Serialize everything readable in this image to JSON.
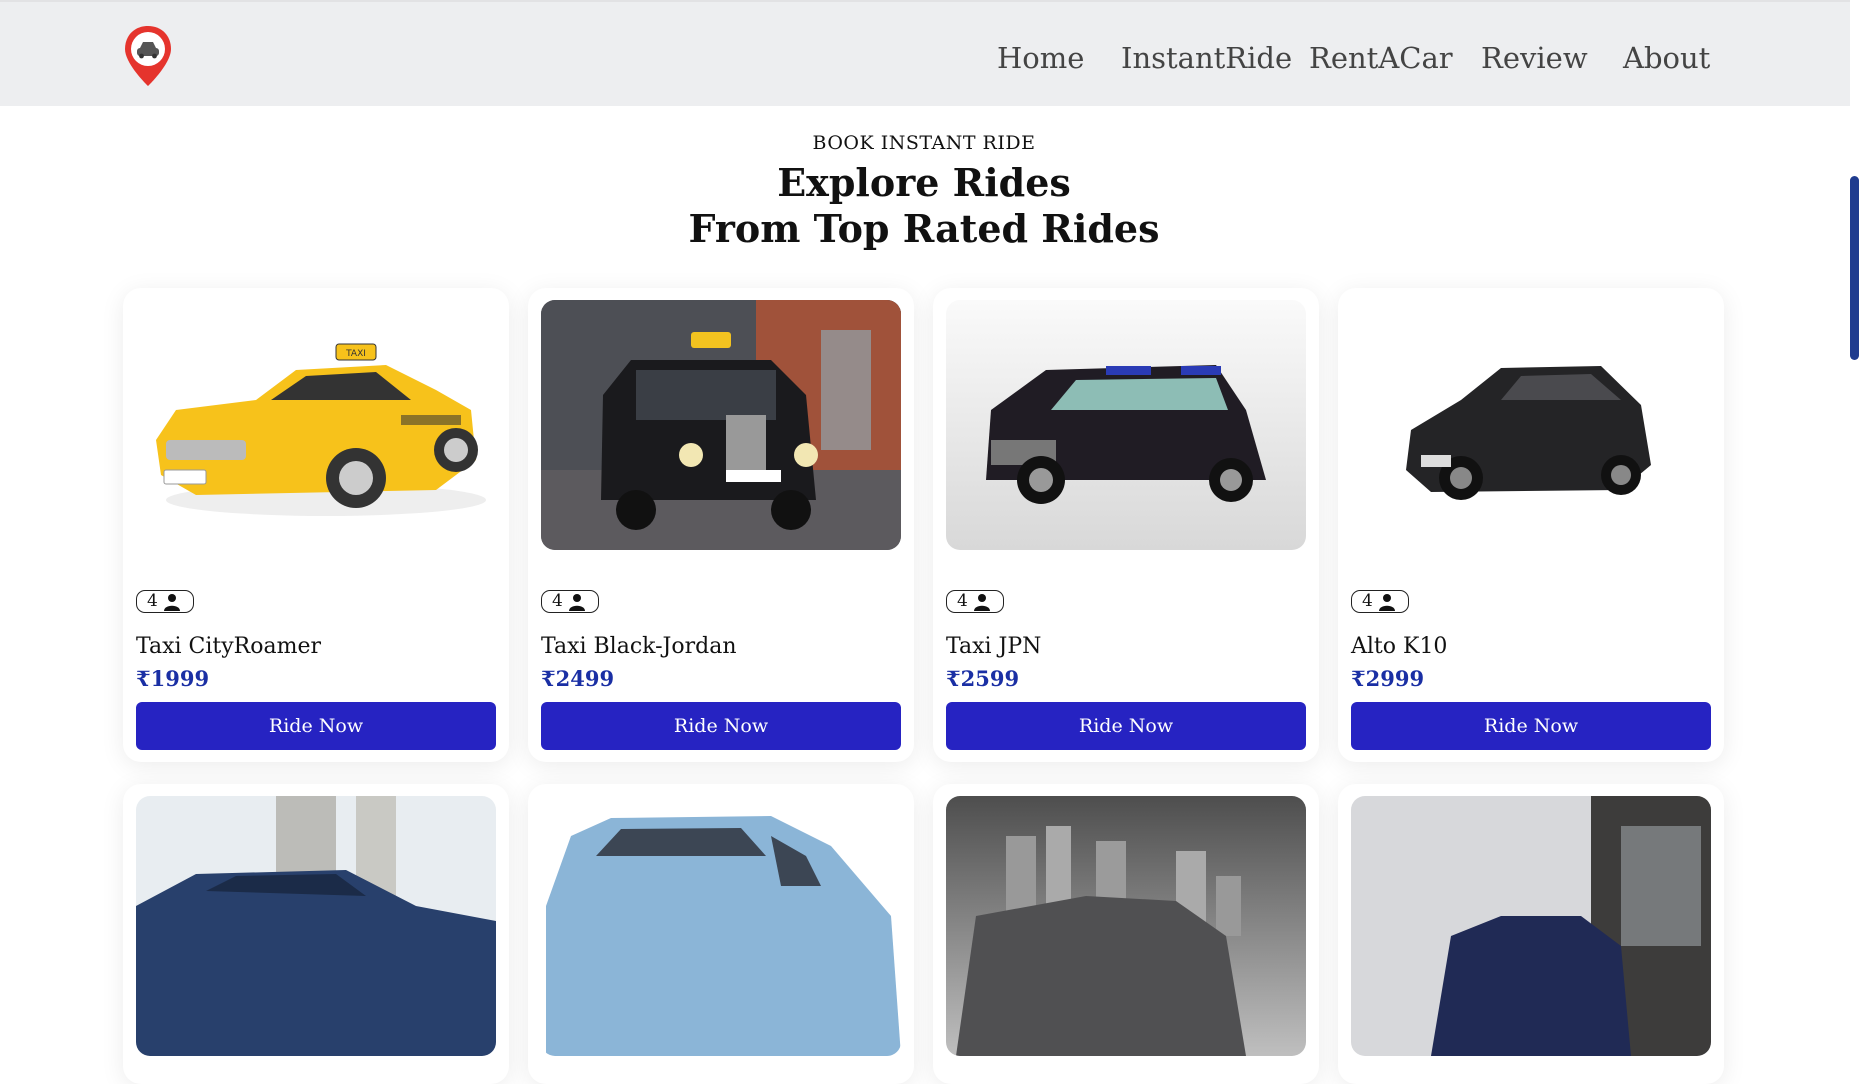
{
  "navbar": {
    "logo_icon": "map-pin-car-icon",
    "links": [
      "Home",
      "InstantRide",
      "RentACar",
      "Review",
      "About"
    ]
  },
  "hero": {
    "eyebrow": "BOOK INSTANT RIDE",
    "title_line1": "Explore Rides",
    "title_line2": "From Top Rated Rides"
  },
  "cars": [
    {
      "seats": "4",
      "name": "Taxi CityRoamer",
      "price": "₹1999",
      "button": "Ride Now",
      "image": "yellow-taxi"
    },
    {
      "seats": "4",
      "name": "Taxi Black-Jordan",
      "price": "₹2499",
      "button": "Ride Now",
      "image": "black-london-cab"
    },
    {
      "seats": "4",
      "name": "Taxi JPN",
      "price": "₹2599",
      "button": "Ride Now",
      "image": "japan-taxi"
    },
    {
      "seats": "4",
      "name": "Alto K10",
      "price": "₹2999",
      "button": "Ride Now",
      "image": "black-hatchback"
    }
  ],
  "more_cars": [
    {
      "image": "blue-sedan"
    },
    {
      "image": "light-blue-mpv"
    },
    {
      "image": "city-suv"
    },
    {
      "image": "navy-car"
    }
  ],
  "colors": {
    "accent": "#2623c2",
    "price": "#1a2fa4",
    "navbar_bg": "#edeef0",
    "scrollbar": "#1f3c8f"
  }
}
